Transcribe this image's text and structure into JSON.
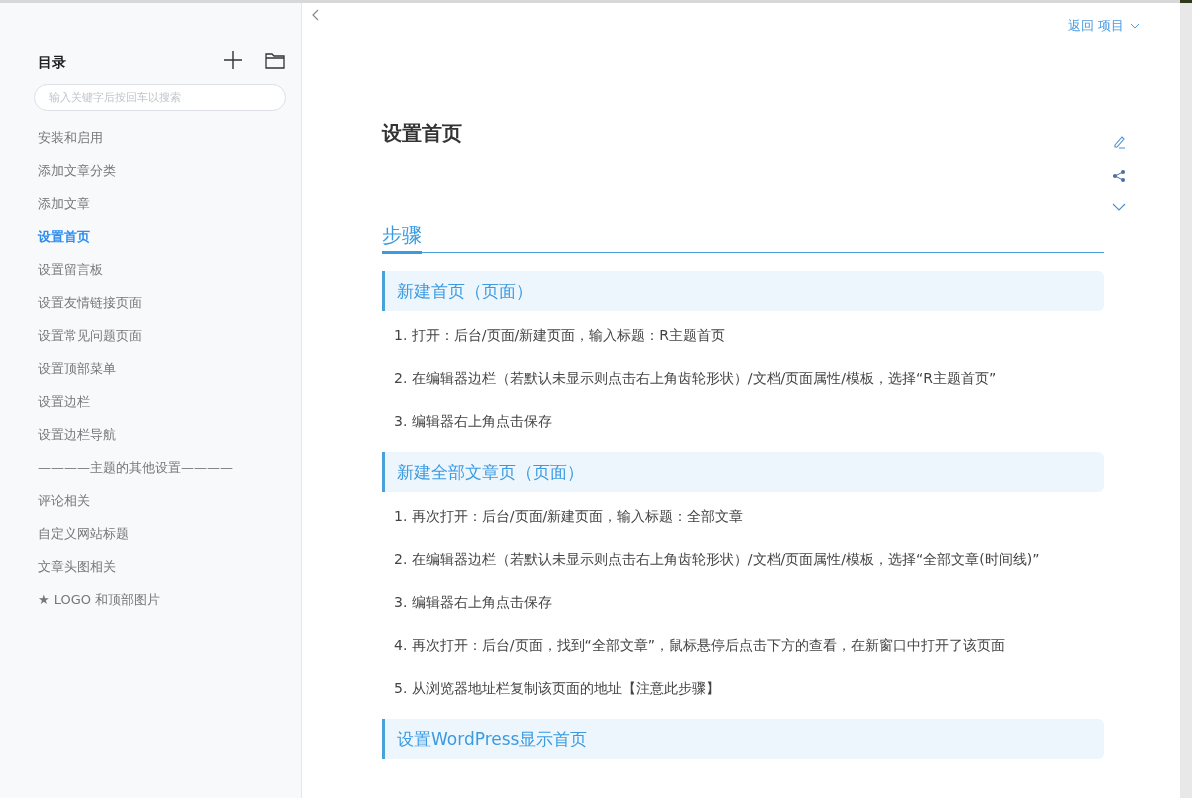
{
  "sidebar": {
    "title": "目录",
    "search": {
      "placeholder": "输入关键字后按回车以搜索"
    },
    "items": [
      {
        "label": "安装和启用",
        "kind": "link",
        "selected": false
      },
      {
        "label": "添加文章分类",
        "kind": "link",
        "selected": false
      },
      {
        "label": "添加文章",
        "kind": "link",
        "selected": false
      },
      {
        "label": "设置首页",
        "kind": "link",
        "selected": true
      },
      {
        "label": "设置留言板",
        "kind": "link",
        "selected": false
      },
      {
        "label": "设置友情链接页面",
        "kind": "link",
        "selected": false
      },
      {
        "label": "设置常见问题页面",
        "kind": "link",
        "selected": false
      },
      {
        "label": "设置顶部菜单",
        "kind": "link",
        "selected": false
      },
      {
        "label": "设置边栏",
        "kind": "link",
        "selected": false
      },
      {
        "label": "设置边栏导航",
        "kind": "link",
        "selected": false
      },
      {
        "label": "————主题的其他设置————",
        "kind": "separator"
      },
      {
        "label": "评论相关",
        "kind": "link",
        "selected": false
      },
      {
        "label": "自定义网站标题",
        "kind": "link",
        "selected": false
      },
      {
        "label": "文章头图相关",
        "kind": "link",
        "selected": false
      },
      {
        "label": "★ LOGO 和顶部图片",
        "kind": "link",
        "selected": false
      }
    ]
  },
  "top_link": "返回 项目",
  "article": {
    "title": "设置首页",
    "section_title": "步骤",
    "sections": [
      {
        "heading": "新建首页（页面）",
        "steps": [
          "1. 打开：后台/页面/新建页面，输入标题：R主题首页",
          "2. 在编辑器边栏（若默认未显示则点击右上角齿轮形状）/文档/页面属性/模板，选择“R主题首页”",
          "3. 编辑器右上角点击保存"
        ]
      },
      {
        "heading": "新建全部文章页（页面）",
        "steps": [
          "1. 再次打开：后台/页面/新建页面，输入标题：全部文章",
          "2. 在编辑器边栏（若默认未显示则点击右上角齿轮形状）/文档/页面属性/模板，选择“全部文章(时间线)”",
          "3. 编辑器右上角点击保存",
          "4. 再次打开：后台/页面，找到“全部文章”，鼠标悬停后点击下方的查看，在新窗口中打开了该页面",
          "5. 从浏览器地址栏复制该页面的地址【注意此步骤】"
        ]
      },
      {
        "heading": "设置WordPress显示首页"
      }
    ]
  }
}
